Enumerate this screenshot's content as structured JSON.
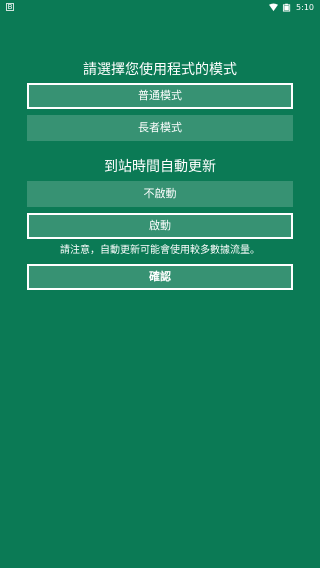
{
  "status_bar": {
    "left_icon_text": "B",
    "time": "5:10"
  },
  "mode_section": {
    "title": "請選擇您使用程式的模式",
    "options": [
      "普通模式",
      "長者模式"
    ],
    "selected_index": 0
  },
  "auto_update_section": {
    "title": "到站時間自動更新",
    "options": [
      "不啟動",
      "啟動"
    ],
    "selected_index": 1
  },
  "note": "請注意，自動更新可能會使用較多數據流量。",
  "confirm_button": "確認",
  "colors": {
    "background": "#0b7a55",
    "button_fill": "rgba(255,255,255,0.18)",
    "text": "#ffffff"
  },
  "icons": [
    "notification-icon",
    "wifi-icon",
    "battery-icon"
  ]
}
